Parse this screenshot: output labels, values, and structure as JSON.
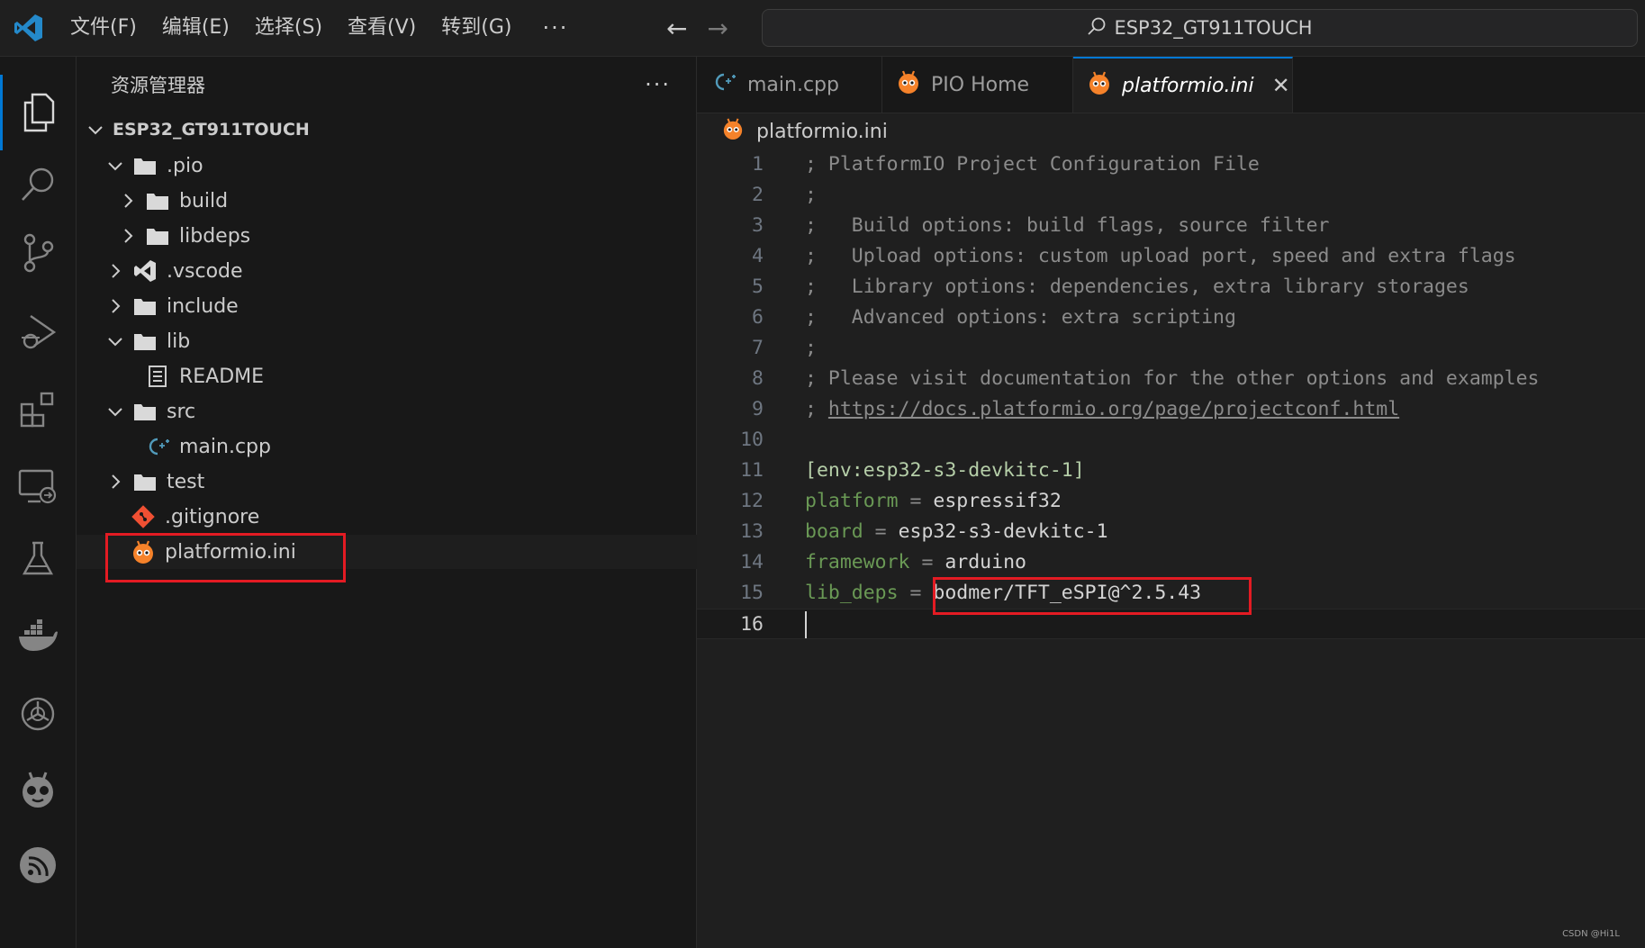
{
  "menu": {
    "items": [
      "文件(F)",
      "编辑(E)",
      "选择(S)",
      "查看(V)",
      "转到(G)"
    ],
    "more": "···"
  },
  "nav": {
    "back": "←",
    "forward": "→"
  },
  "command_center": {
    "text": "ESP32_GT911TOUCH"
  },
  "activity_bar": {
    "icons": [
      "explorer-icon",
      "search-icon",
      "source-control-icon",
      "run-debug-icon",
      "extensions-icon",
      "remote-explorer-icon",
      "testing-icon",
      "docker-icon",
      "ai-chat-icon",
      "platformio-icon",
      "espressif-icon"
    ],
    "active": "explorer-icon"
  },
  "sidebar": {
    "title": "资源管理器",
    "more": "···",
    "root": "ESP32_GT911TOUCH",
    "tree": [
      {
        "label": ".pio",
        "type": "folder",
        "expanded": true
      },
      {
        "label": "build",
        "type": "folder",
        "expanded": false
      },
      {
        "label": "libdeps",
        "type": "folder",
        "expanded": false
      },
      {
        "label": ".vscode",
        "type": "folder",
        "expanded": false
      },
      {
        "label": "include",
        "type": "folder",
        "expanded": false
      },
      {
        "label": "lib",
        "type": "folder",
        "expanded": true
      },
      {
        "label": "README",
        "type": "file"
      },
      {
        "label": "src",
        "type": "folder",
        "expanded": true
      },
      {
        "label": "main.cpp",
        "type": "file"
      },
      {
        "label": "test",
        "type": "folder",
        "expanded": false
      },
      {
        "label": ".gitignore",
        "type": "file"
      },
      {
        "label": "platformio.ini",
        "type": "file",
        "selected": true
      }
    ]
  },
  "tabs": [
    {
      "label": "main.cpp",
      "active": false
    },
    {
      "label": "PIO Home",
      "active": false
    },
    {
      "label": "platformio.ini",
      "active": true,
      "close": "✕"
    }
  ],
  "breadcrumb": {
    "file": "platformio.ini"
  },
  "editor": {
    "current_line": 16,
    "lines": [
      {
        "n": "1",
        "text": "; PlatformIO Project Configuration File"
      },
      {
        "n": "2",
        "text": ";"
      },
      {
        "n": "3",
        "text": ";   Build options: build flags, source filter"
      },
      {
        "n": "4",
        "text": ";   Upload options: custom upload port, speed and extra flags"
      },
      {
        "n": "5",
        "text": ";   Library options: dependencies, extra library storages"
      },
      {
        "n": "6",
        "text": ";   Advanced options: extra scripting"
      },
      {
        "n": "7",
        "text": ";"
      },
      {
        "n": "8",
        "text": "; Please visit documentation for the other options and examples"
      },
      {
        "n": "9",
        "prefix": "; ",
        "link": "https://docs.platformio.org/page/projectconf.html"
      },
      {
        "n": "10",
        "text": ""
      },
      {
        "n": "11",
        "section": "[env:esp32-s3-devkitc-1]"
      },
      {
        "n": "12",
        "key": "platform",
        "eq": " = ",
        "value": "espressif32"
      },
      {
        "n": "13",
        "key": "board",
        "eq": " = ",
        "value": "esp32-s3-devkitc-1"
      },
      {
        "n": "14",
        "key": "framework",
        "eq": " = ",
        "value": "arduino"
      },
      {
        "n": "15",
        "key": "lib_deps",
        "eq": " = ",
        "value": "bodmer/TFT_eSPI@^2.5.43"
      },
      {
        "n": "16",
        "text": ""
      }
    ]
  },
  "watermark": "CSDN @Hi1L",
  "colors": {
    "highlight_box": "#e31b23",
    "accent": "#0078d4",
    "platformio_orange": "#f5822a"
  }
}
